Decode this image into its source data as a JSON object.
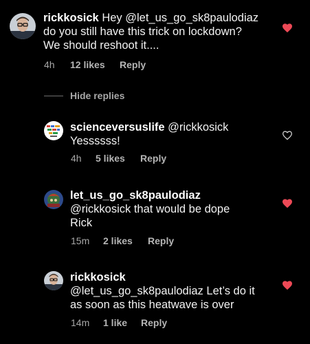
{
  "colors": {
    "background": "#000000",
    "like_red": "#ed4956",
    "meta_gray": "#a8a8a8"
  },
  "comment_main": {
    "username": "rickkosick",
    "text_line1": "Hey @let_us_go_sk8paulodiaz",
    "text_line2": "do you still have this trick on lockdown?",
    "text_line3": "We should reshoot it....",
    "time": "4h",
    "likes": "12 likes",
    "reply_label": "Reply",
    "liked": true
  },
  "hide_replies_label": "Hide replies",
  "replies": [
    {
      "username": "scienceversuslife",
      "line1_rest": " @rickkosick",
      "line2": "Yessssss!",
      "time": "4h",
      "likes": "5 likes",
      "reply_label": "Reply",
      "liked": false
    },
    {
      "username": "let_us_go_sk8paulodiaz",
      "line2": "@rickkosick that would be dope",
      "line3": "Rick",
      "time": "15m",
      "likes": "2 likes",
      "reply_label": "Reply",
      "liked": true
    },
    {
      "username": "rickkosick",
      "line2": "@let_us_go_sk8paulodiaz Let’s do it",
      "line3": "as soon as this heatwave is over",
      "time": "14m",
      "likes": "1 like",
      "reply_label": "Reply",
      "liked": true
    }
  ]
}
